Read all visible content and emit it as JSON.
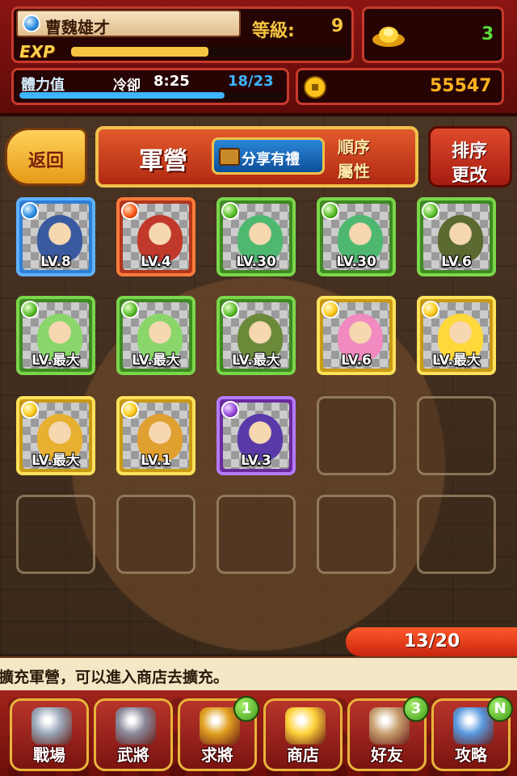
{
  "header": {
    "player_name": "曹魏雄才",
    "level_label": "等級:",
    "level_value": "9",
    "exp_label": "EXP",
    "exp_progress": 0.5,
    "ingot_value": "3",
    "stamina_label": "體力值",
    "cooldown_label": "冷卻",
    "cooldown_value": "8:25",
    "stamina_value": "18/23",
    "stamina_progress": 0.78,
    "coin_value": "55547"
  },
  "toolbar": {
    "back_label": "返回",
    "title": "軍營",
    "share_label": "分享有禮",
    "order_label": "順序",
    "attribute_label": "屬性",
    "sort_line1": "排序",
    "sort_line2": "更改"
  },
  "cards": [
    {
      "element": "water",
      "level": "LV.8",
      "figure": "general-blue-armor"
    },
    {
      "element": "fire",
      "level": "LV.4",
      "figure": "soldier-red"
    },
    {
      "element": "wood",
      "level": "LV.30",
      "figure": "green-hair-warrior"
    },
    {
      "element": "wood",
      "level": "LV.30",
      "figure": "green-hair-warrior"
    },
    {
      "element": "wood",
      "level": "LV.6",
      "figure": "armored-beast"
    },
    {
      "element": "wood",
      "level": "LV.最大",
      "figure": "jade-disc"
    },
    {
      "element": "wood",
      "level": "LV.最大",
      "figure": "jade-disc"
    },
    {
      "element": "wood",
      "level": "LV.最大",
      "figure": "bamboo-scroll"
    },
    {
      "element": "light",
      "level": "LV.6",
      "figure": "pink-hair-girl"
    },
    {
      "element": "light",
      "level": "LV.最大",
      "figure": "gold-disc"
    },
    {
      "element": "light",
      "level": "LV.最大",
      "figure": "gold-scroll"
    },
    {
      "element": "light",
      "level": "LV.1",
      "figure": "soldier-yellow"
    },
    {
      "element": "dark",
      "level": "LV.3",
      "figure": "purple-hair-warrior"
    }
  ],
  "empty_slots": 7,
  "capacity": "13/20",
  "ticker_text": "擴充軍營，可以進入商店去擴充。",
  "nav": [
    {
      "label": "戰場",
      "icon": "crossed-swords-icon",
      "badge": ""
    },
    {
      "label": "武將",
      "icon": "helmet-icon",
      "badge": ""
    },
    {
      "label": "求將",
      "icon": "recruit-icon",
      "badge": "1"
    },
    {
      "label": "商店",
      "icon": "gold-ingots-icon",
      "badge": ""
    },
    {
      "label": "好友",
      "icon": "fist-icon",
      "badge": "3"
    },
    {
      "label": "攻略",
      "icon": "guide-book-icon",
      "badge": "N"
    }
  ],
  "colors": {
    "water": "#2e7fd6",
    "fire": "#b3361c",
    "wood": "#3e8a22",
    "light": "#c99a14",
    "dark": "#6a2a9e",
    "exp_bar": "#f5c542",
    "stamina_bar": "#3fb4ff"
  }
}
